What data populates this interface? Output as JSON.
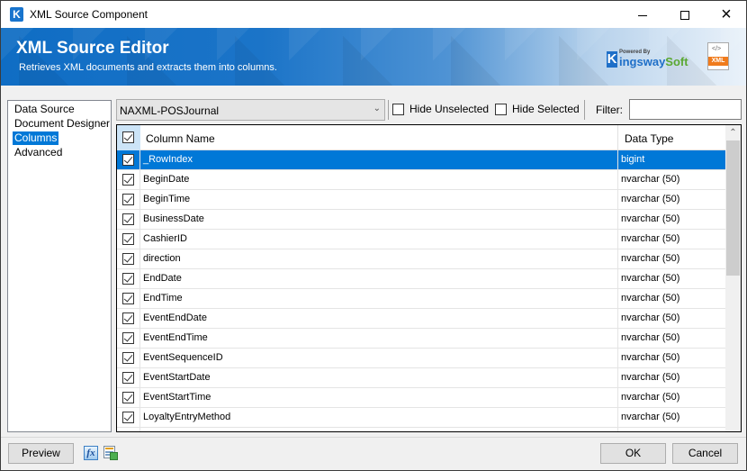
{
  "window": {
    "title": "XML Source Component",
    "app_icon": "K",
    "controls": {
      "minimize": "minimize-icon",
      "maximize": "maximize-icon",
      "close": "×"
    }
  },
  "banner": {
    "title": "XML Source Editor",
    "subtitle": "Retrieves XML documents and extracts them into columns.",
    "logo": {
      "powered_by": "Powered By",
      "k": "K",
      "name_a": "ingsway",
      "name_b": "Soft"
    },
    "xml_icon": {
      "code": "</>",
      "tag": "XML"
    }
  },
  "nav": {
    "items": [
      {
        "label": "Data Source",
        "selected": false
      },
      {
        "label": "Document Designer",
        "selected": false
      },
      {
        "label": "Columns",
        "selected": true
      },
      {
        "label": "Advanced",
        "selected": false
      }
    ]
  },
  "toolbar": {
    "output_select": "NAXML-POSJournal",
    "hide_unselected_label": "Hide Unselected",
    "hide_unselected_checked": false,
    "hide_selected_label": "Hide Selected",
    "hide_selected_checked": false,
    "filter_label": "Filter:",
    "filter_value": ""
  },
  "grid": {
    "headers": {
      "name": "Column Name",
      "type": "Data Type"
    },
    "header_checked": true,
    "rows": [
      {
        "name": "_RowIndex",
        "type": "bigint",
        "checked": true,
        "selected": true
      },
      {
        "name": "BeginDate",
        "type": "nvarchar (50)",
        "checked": true,
        "selected": false
      },
      {
        "name": "BeginTime",
        "type": "nvarchar (50)",
        "checked": true,
        "selected": false
      },
      {
        "name": "BusinessDate",
        "type": "nvarchar (50)",
        "checked": true,
        "selected": false
      },
      {
        "name": "CashierID",
        "type": "nvarchar (50)",
        "checked": true,
        "selected": false
      },
      {
        "name": "direction",
        "type": "nvarchar (50)",
        "checked": true,
        "selected": false
      },
      {
        "name": "EndDate",
        "type": "nvarchar (50)",
        "checked": true,
        "selected": false
      },
      {
        "name": "EndTime",
        "type": "nvarchar (50)",
        "checked": true,
        "selected": false
      },
      {
        "name": "EventEndDate",
        "type": "nvarchar (50)",
        "checked": true,
        "selected": false
      },
      {
        "name": "EventEndTime",
        "type": "nvarchar (50)",
        "checked": true,
        "selected": false
      },
      {
        "name": "EventSequenceID",
        "type": "nvarchar (50)",
        "checked": true,
        "selected": false
      },
      {
        "name": "EventStartDate",
        "type": "nvarchar (50)",
        "checked": true,
        "selected": false
      },
      {
        "name": "EventStartTime",
        "type": "nvarchar (50)",
        "checked": true,
        "selected": false
      },
      {
        "name": "LoyaltyEntryMethod",
        "type": "nvarchar (50)",
        "checked": true,
        "selected": false
      },
      {
        "name": "",
        "type": "",
        "checked": false,
        "selected": false
      }
    ]
  },
  "footer": {
    "preview_label": "Preview",
    "fx_icon": "fx",
    "ok_label": "OK",
    "cancel_label": "Cancel"
  }
}
